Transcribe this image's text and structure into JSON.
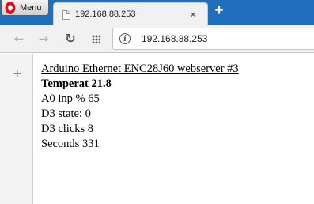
{
  "browser": {
    "menu_label": "Menu",
    "tab": {
      "title": "192.168.88.253",
      "close_glyph": "×"
    },
    "new_tab_glyph": "+",
    "nav": {
      "back_glyph": "←",
      "forward_glyph": "→",
      "reload_glyph": "↻"
    },
    "address": {
      "value": "192.168.88.253",
      "info_glyph": "i"
    },
    "sidebar": {
      "add_glyph": "+"
    }
  },
  "page": {
    "link": "Arduino Ethernet ENC28J60 webserver #3",
    "temperature": "Temperat 21.8",
    "lines": [
      "A0 inp % 65",
      "D3 state: 0",
      "D3 clicks 8",
      "Seconds 331"
    ]
  },
  "colors": {
    "tabstrip": "#1f6fbd",
    "toolbar": "#f1f1f1",
    "opera_red": "#d8121d"
  }
}
